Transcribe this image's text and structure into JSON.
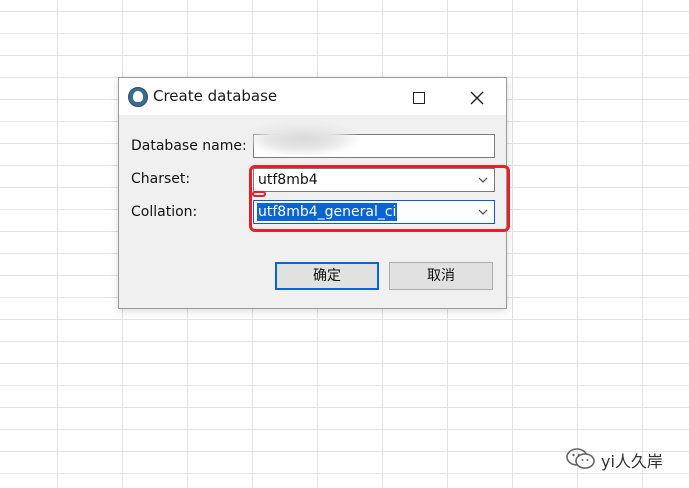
{
  "dialog": {
    "title": "Create database",
    "labels": {
      "database_name": "Database name:",
      "charset": "Charset:",
      "collation": "Collation:"
    },
    "fields": {
      "database_name": "",
      "charset": "utf8mb4",
      "collation": "utf8mb4_general_ci"
    },
    "buttons": {
      "ok": "确定",
      "cancel": "取消"
    },
    "highlight_color": "#e8202a",
    "selection_color": "#0a64d4"
  },
  "watermark": {
    "text": "yi人久岸",
    "icon": "wechat-icon"
  }
}
